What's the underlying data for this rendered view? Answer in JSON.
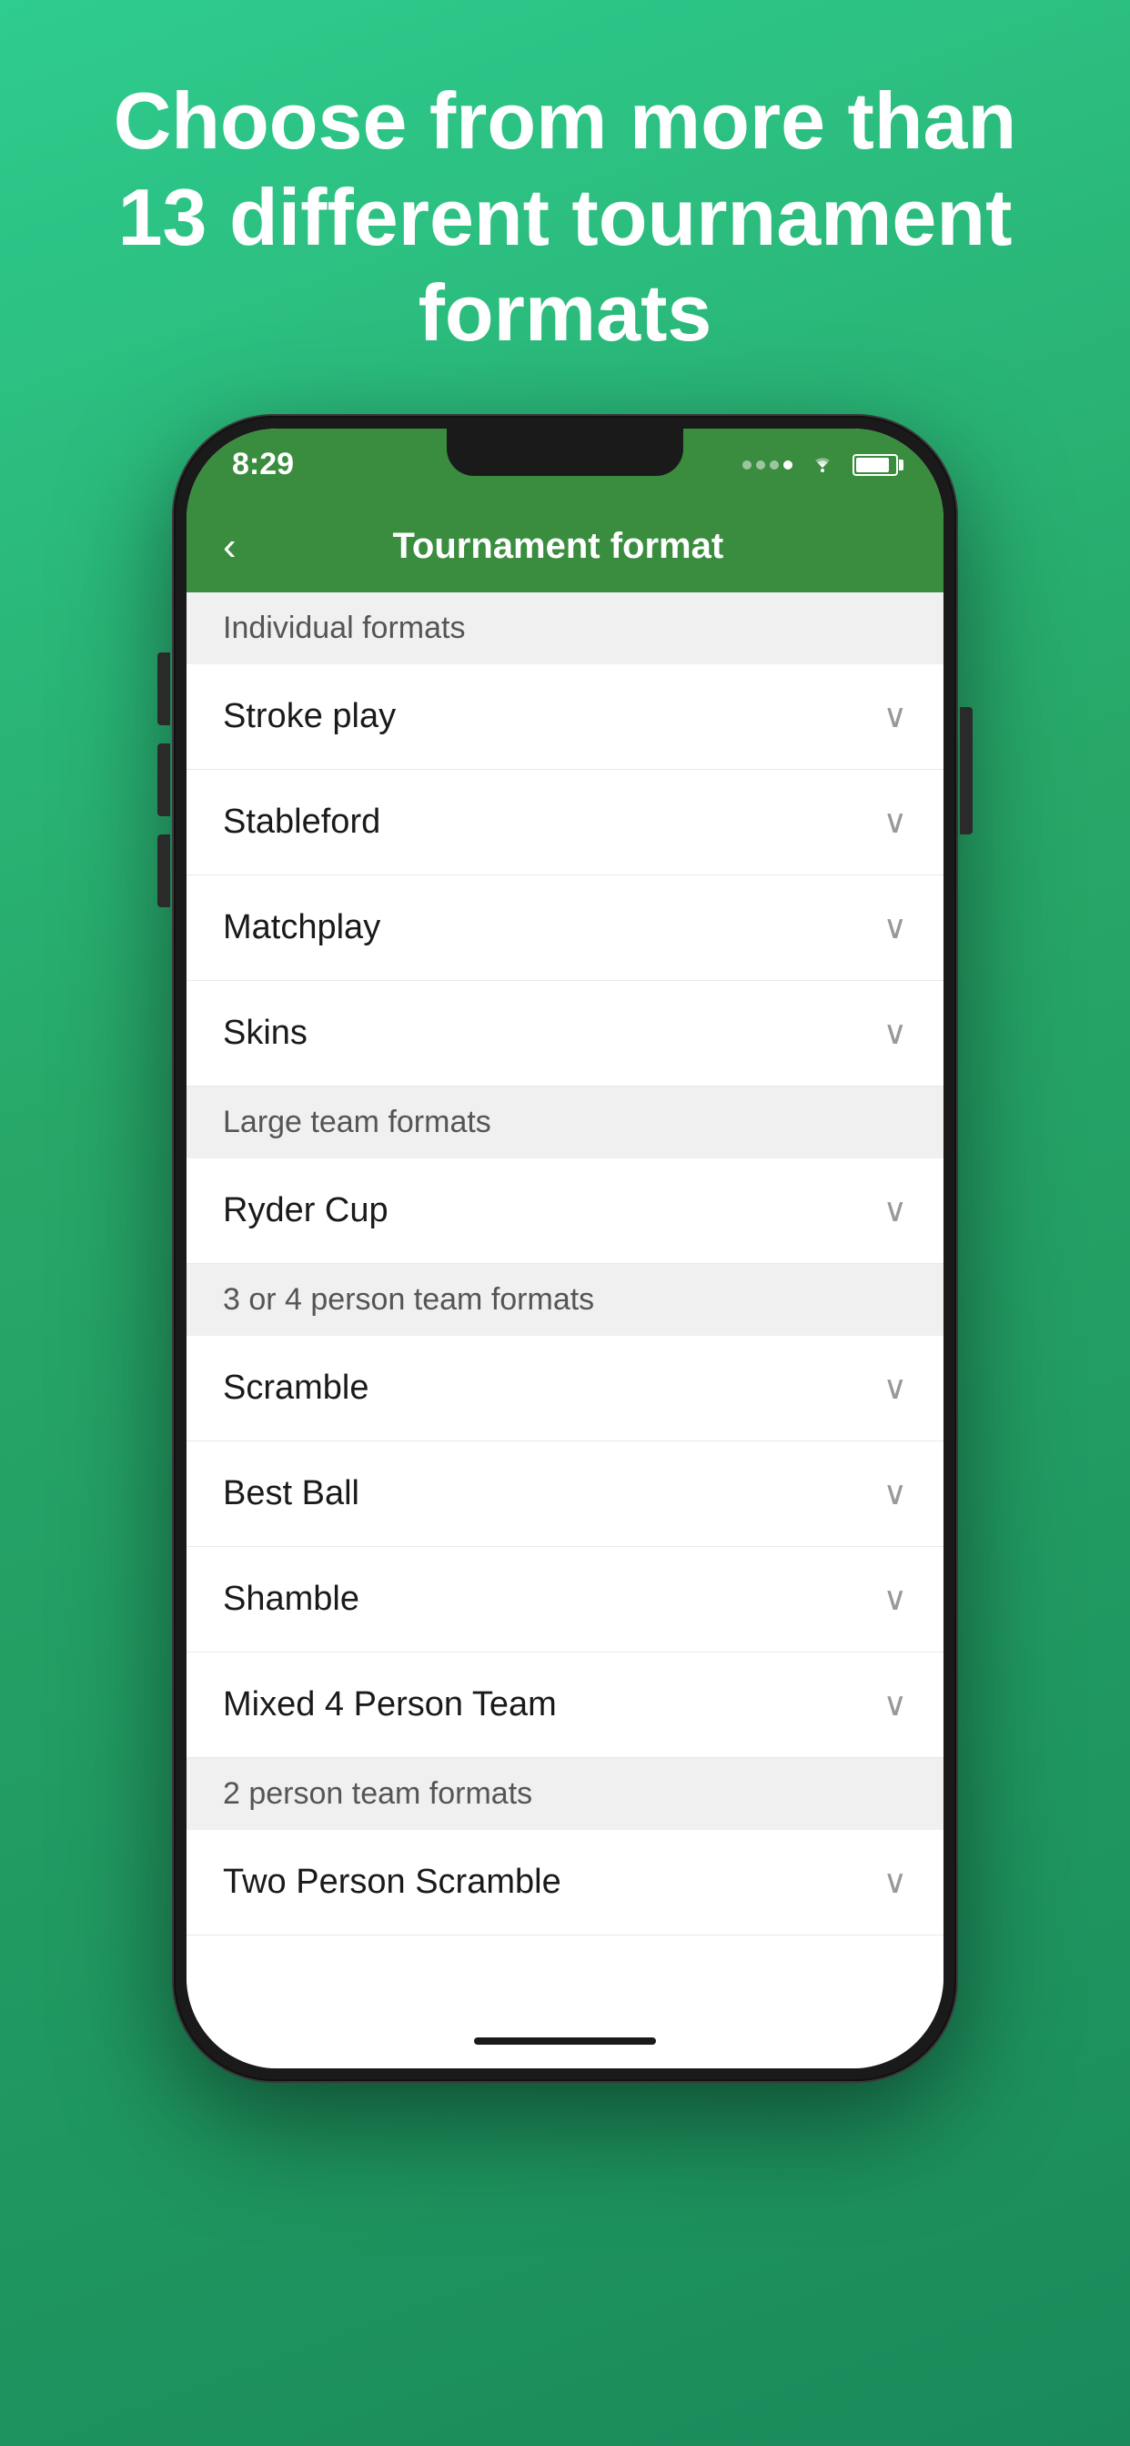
{
  "hero": {
    "text": "Choose from more than 13 different tournament formats"
  },
  "statusBar": {
    "time": "8:29"
  },
  "navBar": {
    "backLabel": "‹",
    "title": "Tournament format"
  },
  "sections": [
    {
      "id": "individual-formats",
      "header": "Individual formats",
      "items": [
        {
          "id": "stroke-play",
          "label": "Stroke play"
        },
        {
          "id": "stableford",
          "label": "Stableford"
        },
        {
          "id": "matchplay",
          "label": "Matchplay"
        },
        {
          "id": "skins",
          "label": "Skins"
        }
      ]
    },
    {
      "id": "large-team-formats",
      "header": "Large team formats",
      "items": [
        {
          "id": "ryder-cup",
          "label": "Ryder Cup"
        }
      ]
    },
    {
      "id": "3-or-4-person-team-formats",
      "header": "3 or 4 person team formats",
      "items": [
        {
          "id": "scramble",
          "label": "Scramble"
        },
        {
          "id": "best-ball",
          "label": "Best Ball"
        },
        {
          "id": "shamble",
          "label": "Shamble"
        },
        {
          "id": "mixed-4-person-team",
          "label": "Mixed 4 Person Team"
        }
      ]
    },
    {
      "id": "2-person-team-formats",
      "header": "2 person team formats",
      "items": [
        {
          "id": "two-person-scramble",
          "label": "Two Person Scramble"
        }
      ]
    }
  ]
}
